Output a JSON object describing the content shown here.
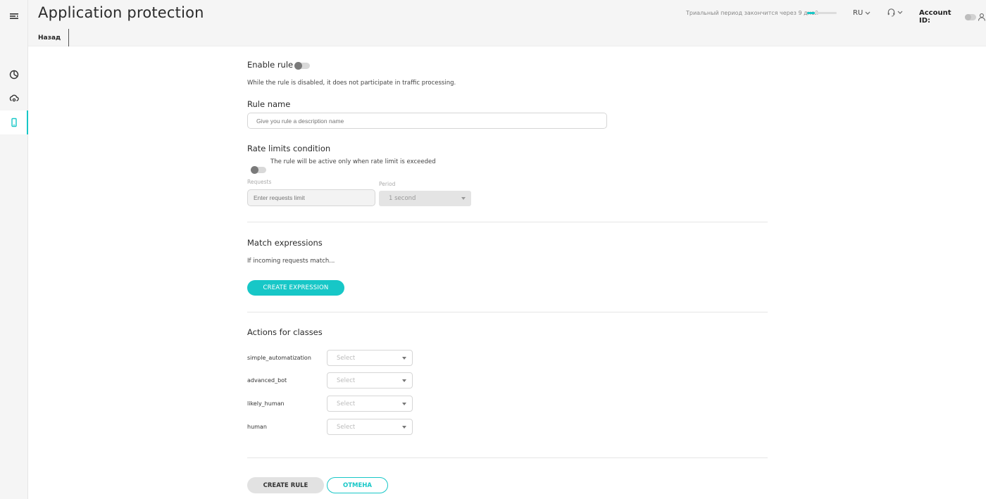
{
  "header": {
    "title": "Application protection",
    "trial_text": "Триальный период закончится через 9 дней",
    "trial_progress": 0.25,
    "language": "RU",
    "account_label": "Account ID:"
  },
  "subbar": {
    "back_label": "Назад"
  },
  "sidebar": {
    "items": [
      {
        "icon": "menu-icon"
      },
      {
        "icon": "dashboard-pie-icon"
      },
      {
        "icon": "cloud-shield-icon"
      },
      {
        "icon": "mobile-app-icon",
        "active": true
      }
    ]
  },
  "form": {
    "enable_rule_label": "Enable rule",
    "enable_rule_hint": "While the rule is disabled, it does not participate in traffic processing.",
    "rule_name_label": "Rule name",
    "rule_name_placeholder": "Give you rule a description name",
    "rate_limits_label": "Rate limits condition",
    "rate_limits_hint": "The rule will be active only when rate limit is exceeded",
    "requests_label": "Requests",
    "requests_placeholder": "Enter requests limit",
    "period_label": "Period",
    "period_value": "1 second",
    "match_label": "Match expressions",
    "match_hint": "If incoming requests match...",
    "create_expression_label": "CREATE EXPRESSION",
    "actions_label": "Actions for classes",
    "classes": [
      {
        "name": "simple_automatization",
        "value": "Select"
      },
      {
        "name": "advanced_bot",
        "value": "Select"
      },
      {
        "name": "likely_human",
        "value": "Select"
      },
      {
        "name": "human",
        "value": "Select"
      }
    ],
    "create_rule_label": "CREATE RULE",
    "cancel_label": "ОТМЕНА"
  },
  "colors": {
    "accent": "#17c7c7",
    "sidebar_bg": "#f5f5f5"
  }
}
